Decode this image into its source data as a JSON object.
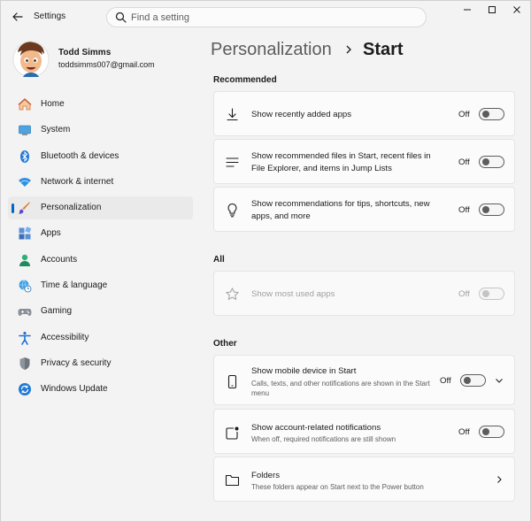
{
  "window": {
    "title": "Settings"
  },
  "search": {
    "placeholder": "Find a setting"
  },
  "profile": {
    "name": "Todd Simms",
    "email": "toddsimms007@gmail.com"
  },
  "sidebar": {
    "items": [
      {
        "label": "Home",
        "icon": "home-icon"
      },
      {
        "label": "System",
        "icon": "system-icon"
      },
      {
        "label": "Bluetooth & devices",
        "icon": "bluetooth-icon"
      },
      {
        "label": "Network & internet",
        "icon": "wifi-icon"
      },
      {
        "label": "Personalization",
        "icon": "brush-icon",
        "active": true
      },
      {
        "label": "Apps",
        "icon": "apps-icon"
      },
      {
        "label": "Accounts",
        "icon": "accounts-icon"
      },
      {
        "label": "Time & language",
        "icon": "globe-clock-icon"
      },
      {
        "label": "Gaming",
        "icon": "gamepad-icon"
      },
      {
        "label": "Accessibility",
        "icon": "accessibility-icon"
      },
      {
        "label": "Privacy & security",
        "icon": "shield-icon"
      },
      {
        "label": "Windows Update",
        "icon": "update-icon"
      }
    ]
  },
  "breadcrumb": {
    "parent": "Personalization",
    "current": "Start"
  },
  "sections": {
    "recommended": {
      "title": "Recommended",
      "items": [
        {
          "title": "Show recently added apps",
          "state": "Off",
          "icon": "download-icon"
        },
        {
          "title": "Show recommended files in Start, recent files in File Explorer, and items in Jump Lists",
          "state": "Off",
          "icon": "list-icon"
        },
        {
          "title": "Show recommendations for tips, shortcuts, new apps, and more",
          "state": "Off",
          "icon": "lightbulb-icon"
        }
      ]
    },
    "all": {
      "title": "All",
      "items": [
        {
          "title": "Show most used apps",
          "state": "Off",
          "icon": "star-icon",
          "disabled": true
        }
      ]
    },
    "other": {
      "title": "Other",
      "items": [
        {
          "title": "Show mobile device in Start",
          "subtitle": "Calls, texts, and other notifications are shown in the Start menu",
          "state": "Off",
          "icon": "phone-icon"
        },
        {
          "title": "Show account-related notifications",
          "subtitle": "When off, required notifications are still shown",
          "state": "Off",
          "icon": "notification-icon"
        },
        {
          "title": "Folders",
          "subtitle": "These folders appear on Start next to the Power button",
          "icon": "folder-icon"
        }
      ]
    }
  },
  "colors": {
    "accent": "#0067c0",
    "background": "#f3f3f3",
    "card": "#fbfbfb"
  }
}
